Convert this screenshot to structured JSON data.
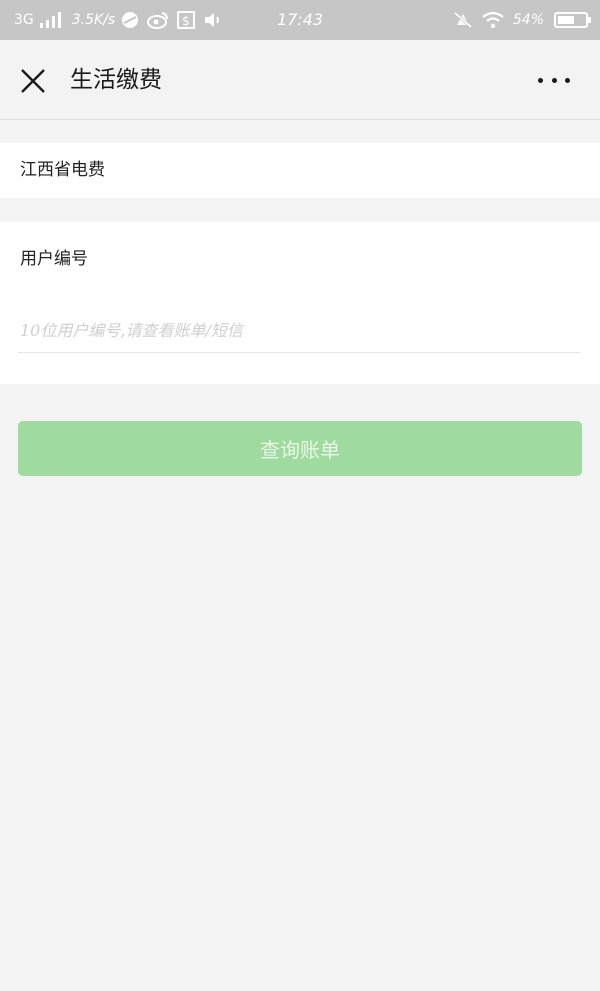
{
  "status_bar": {
    "network": "3G",
    "speed": "3.5K/s",
    "time": "17:43",
    "battery": "54%",
    "battery_level": 0.54
  },
  "nav": {
    "title": "生活缴费",
    "close_icon": "close-icon",
    "more_icon": "more-icon"
  },
  "province": {
    "label": "江西省电费"
  },
  "account": {
    "label": "用户编号",
    "input_value": "",
    "input_placeholder": "10位用户编号,请查看账单/短信"
  },
  "query_button": {
    "label": "查询账单",
    "color": "#9fdb9f"
  }
}
